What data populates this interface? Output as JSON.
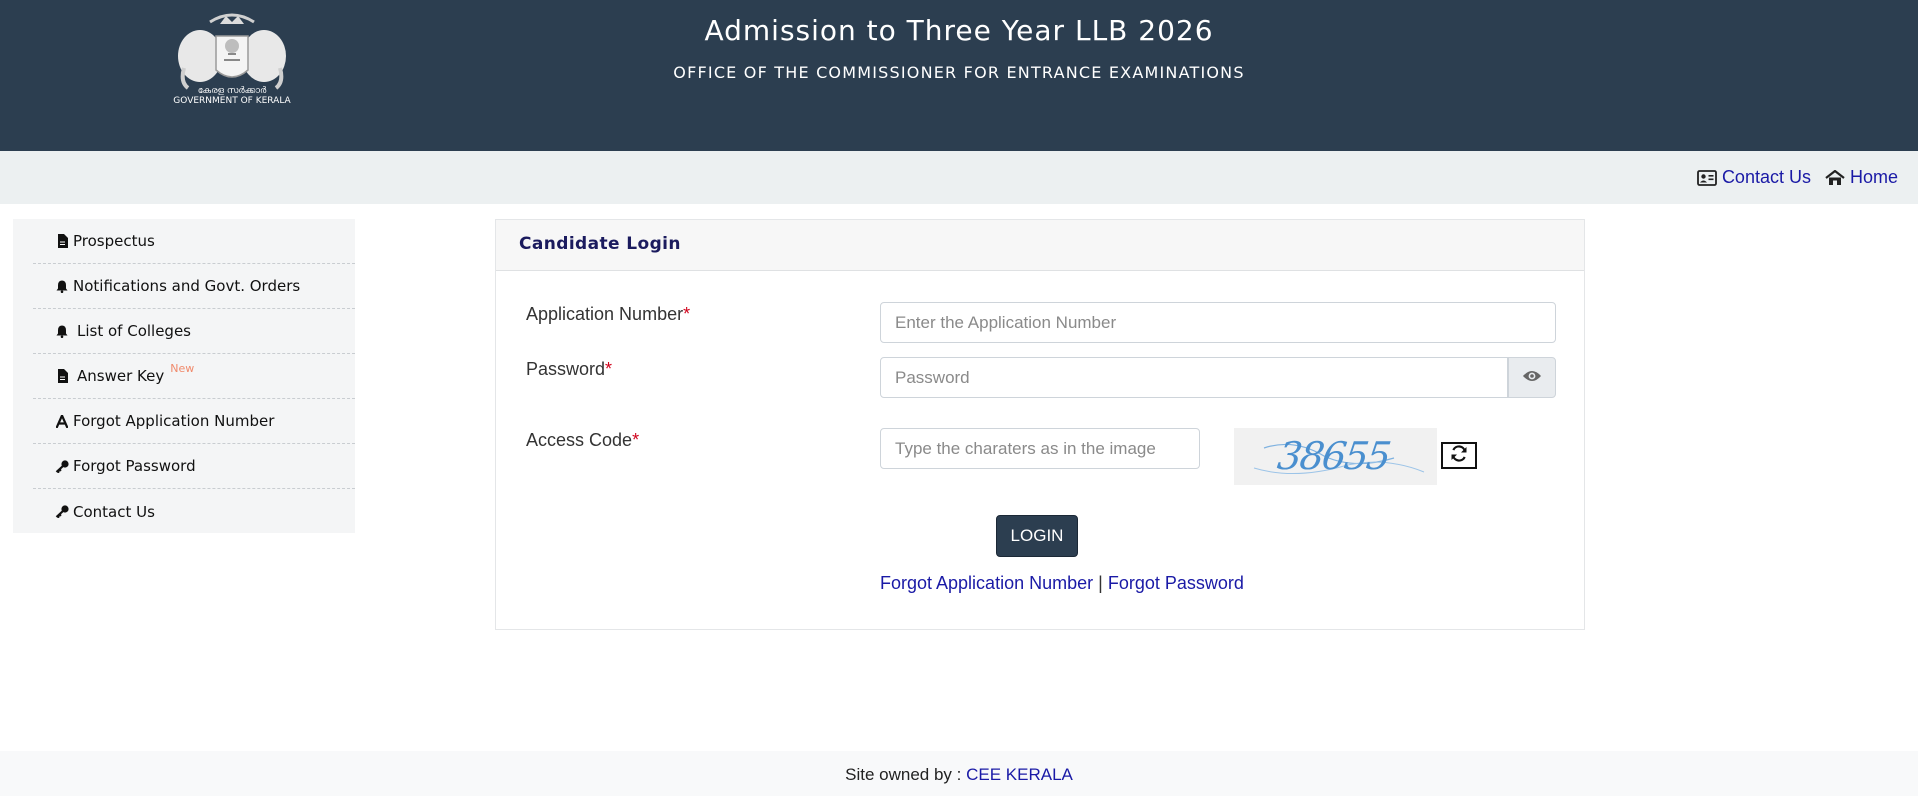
{
  "header": {
    "emblem_caption_ml": "കേരള സർക്കാർ",
    "emblem_caption_en": "GOVERNMENT OF KERALA",
    "title": "Admission to Three Year LLB 2026",
    "subtitle": "OFFICE OF THE COMMISSIONER FOR ENTRANCE EXAMINATIONS"
  },
  "topnav": {
    "contact": {
      "label": "Contact Us",
      "icon": "contact-card-icon"
    },
    "home": {
      "label": "Home",
      "icon": "home-icon"
    }
  },
  "sidebar": {
    "items": [
      {
        "label": "Prospectus",
        "icon": "pdf-file-icon"
      },
      {
        "label": "Notifications and Govt. Orders",
        "icon": "bell-icon"
      },
      {
        "label": "List of Colleges",
        "icon": "bell-icon"
      },
      {
        "label": "Answer Key",
        "icon": "pdf-file-icon",
        "badge": "New"
      },
      {
        "label": "Forgot Application Number",
        "icon": "font-icon"
      },
      {
        "label": "Forgot Password",
        "icon": "key-icon"
      },
      {
        "label": "Contact Us",
        "icon": "key-icon"
      }
    ]
  },
  "login": {
    "title": "Candidate Login",
    "application_number": {
      "label": "Application Number",
      "required": "*",
      "placeholder": "Enter the Application Number",
      "value": ""
    },
    "password": {
      "label": "Password",
      "required": "*",
      "placeholder": "Password",
      "value": "",
      "toggle_icon": "eye-icon"
    },
    "access_code": {
      "label": "Access Code",
      "required": "*",
      "placeholder": "Type the charaters as in the image",
      "value": "",
      "captcha_text": "38655",
      "refresh_icon": "refresh-icon"
    },
    "submit_label": "LOGIN",
    "forgot_app_link": "Forgot Application Number",
    "separator": "|",
    "forgot_pw_link": "Forgot Password"
  },
  "footer": {
    "prefix": "Site owned by :",
    "link": "CEE KERALA"
  },
  "colors": {
    "header_bg": "#2c3e50",
    "nav_bg": "#ecf0f1",
    "link": "#1a1aa6",
    "required": "#d0021b",
    "new_badge": "#f08a6c"
  }
}
